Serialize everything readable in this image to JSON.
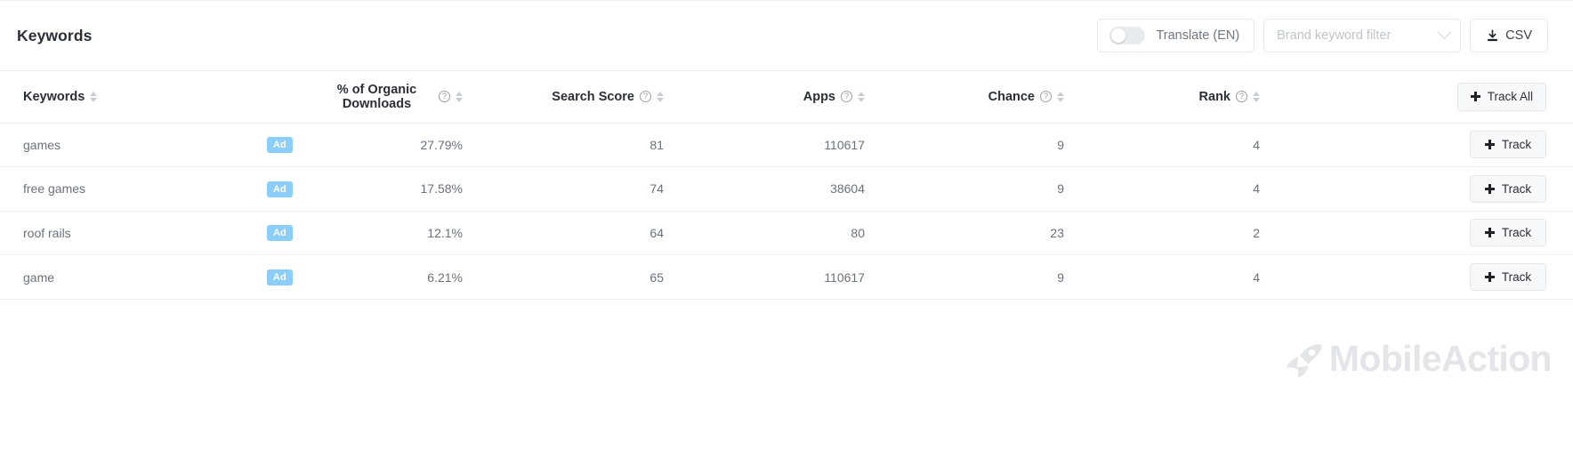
{
  "header": {
    "title": "Keywords",
    "translate": {
      "label": "Translate (EN)",
      "enabled": false
    },
    "brand_filter": {
      "placeholder": "Brand keyword filter",
      "value": ""
    },
    "csv_label": "CSV"
  },
  "table": {
    "columns": [
      {
        "key": "keyword",
        "label": "Keywords",
        "help": false,
        "sortable": true
      },
      {
        "key": "ad",
        "label": "",
        "help": false,
        "sortable": false
      },
      {
        "key": "organic",
        "label": "% of Organic Downloads",
        "help": true,
        "sortable": true
      },
      {
        "key": "score",
        "label": "Search Score",
        "help": true,
        "sortable": true
      },
      {
        "key": "apps",
        "label": "Apps",
        "help": true,
        "sortable": true
      },
      {
        "key": "chance",
        "label": "Chance",
        "help": true,
        "sortable": true
      },
      {
        "key": "rank",
        "label": "Rank",
        "help": true,
        "sortable": true
      }
    ],
    "track_all_label": "Track All",
    "track_label": "Track",
    "ad_badge_label": "Ad",
    "rows": [
      {
        "keyword": "games",
        "ad": "Ad",
        "organic": "27.79%",
        "score": "81",
        "apps": "110617",
        "chance": "9",
        "rank": "4"
      },
      {
        "keyword": "free games",
        "ad": "Ad",
        "organic": "17.58%",
        "score": "74",
        "apps": "38604",
        "chance": "9",
        "rank": "4"
      },
      {
        "keyword": "roof rails",
        "ad": "Ad",
        "organic": "12.1%",
        "score": "64",
        "apps": "80",
        "chance": "23",
        "rank": "2"
      },
      {
        "keyword": "game",
        "ad": "Ad",
        "organic": "6.21%",
        "score": "65",
        "apps": "110617",
        "chance": "9",
        "rank": "4"
      }
    ]
  },
  "watermark": {
    "text": "MobileAction"
  },
  "colors": {
    "ad_badge": "#8ccefa",
    "title": "#2b2f38",
    "cell_text": "#6a717d",
    "border": "#eceff3",
    "watermark": "#e3e5e9"
  }
}
